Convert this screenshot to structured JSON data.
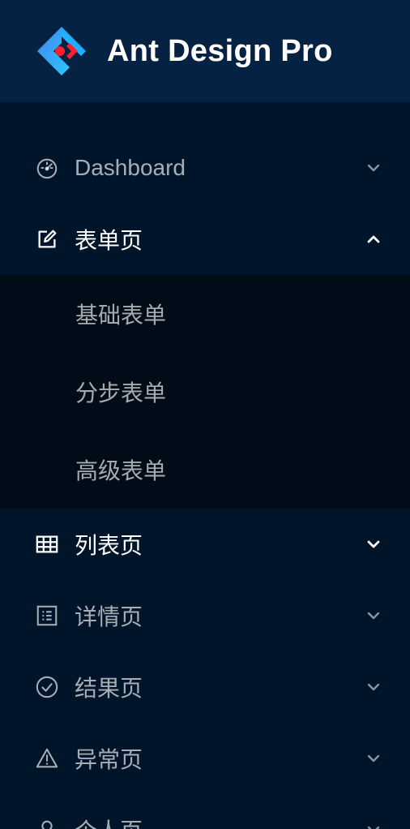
{
  "app": {
    "title": "Ant Design Pro"
  },
  "menu": {
    "items": [
      {
        "label": "Dashboard",
        "icon": "dashboard-icon",
        "state": "collapsed"
      },
      {
        "label": "表单页",
        "icon": "form-icon",
        "state": "expanded",
        "children": [
          {
            "label": "基础表单"
          },
          {
            "label": "分步表单"
          },
          {
            "label": "高级表单"
          }
        ]
      },
      {
        "label": "列表页",
        "icon": "table-icon",
        "state": "collapsed"
      },
      {
        "label": "详情页",
        "icon": "profile-icon",
        "state": "collapsed"
      },
      {
        "label": "结果页",
        "icon": "check-circle-icon",
        "state": "collapsed"
      },
      {
        "label": "异常页",
        "icon": "warning-icon",
        "state": "collapsed"
      },
      {
        "label": "个人页",
        "icon": "user-icon",
        "state": "collapsed"
      }
    ]
  },
  "colors": {
    "sider_bg": "#001529",
    "logo_bg": "#062243",
    "submenu_bg": "#000c17",
    "text_muted": "rgba(255,255,255,0.65)",
    "text_active": "#ffffff",
    "logo_blue": "#1890ff",
    "logo_red": "#f5222d"
  }
}
